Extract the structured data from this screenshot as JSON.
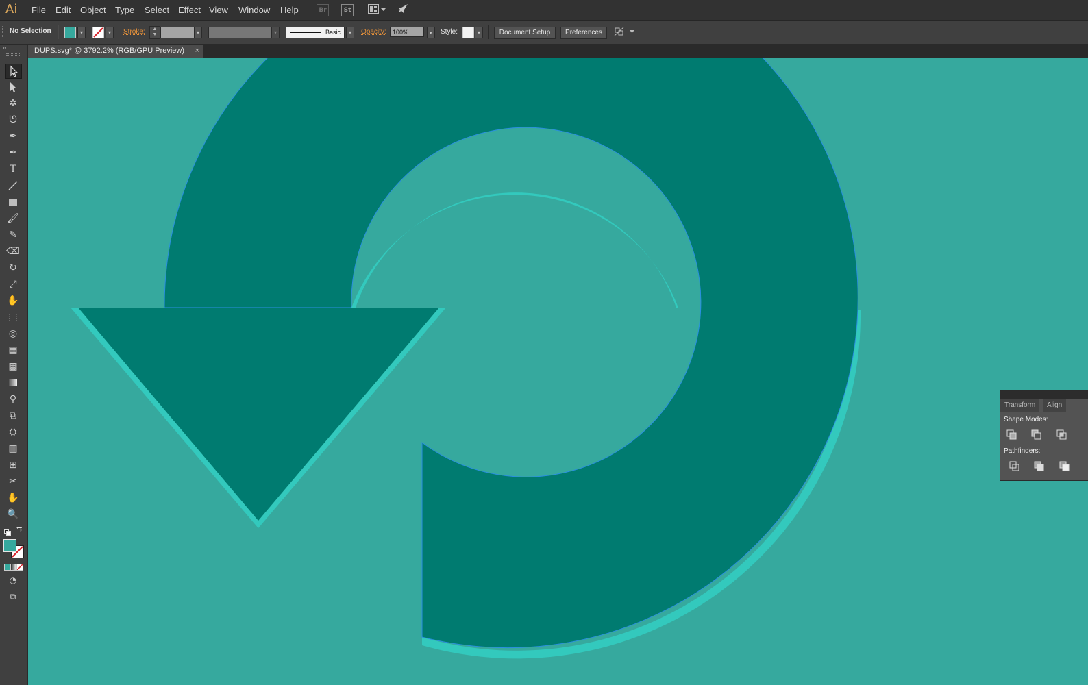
{
  "app": {
    "logo": "Ai"
  },
  "menu": [
    "File",
    "Edit",
    "Object",
    "Type",
    "Select",
    "Effect",
    "View",
    "Window",
    "Help"
  ],
  "menubar_icons": {
    "bridge": "Br",
    "stock": "St"
  },
  "control_bar": {
    "selection": "No Selection",
    "fill_color": "#36a99e",
    "stroke_label": "Stroke:",
    "stroke_style": "Basic",
    "opacity_label": "Opacity:",
    "opacity_value": "100%",
    "style_label": "Style:",
    "document_setup": "Document Setup",
    "preferences": "Preferences"
  },
  "document_tab": {
    "title": "DUPS.svg* @ 3792.2% (RGB/GPU Preview)",
    "close": "×"
  },
  "canvas": {
    "background": "#36a99e",
    "shape_fill": "#007b70",
    "highlight": "#33c9bd",
    "outline": "#2a8fe0"
  },
  "panel": {
    "tabs": [
      "Transform",
      "Align"
    ],
    "shape_modes_label": "Shape Modes:",
    "pathfinders_label": "Pathfinders:"
  }
}
